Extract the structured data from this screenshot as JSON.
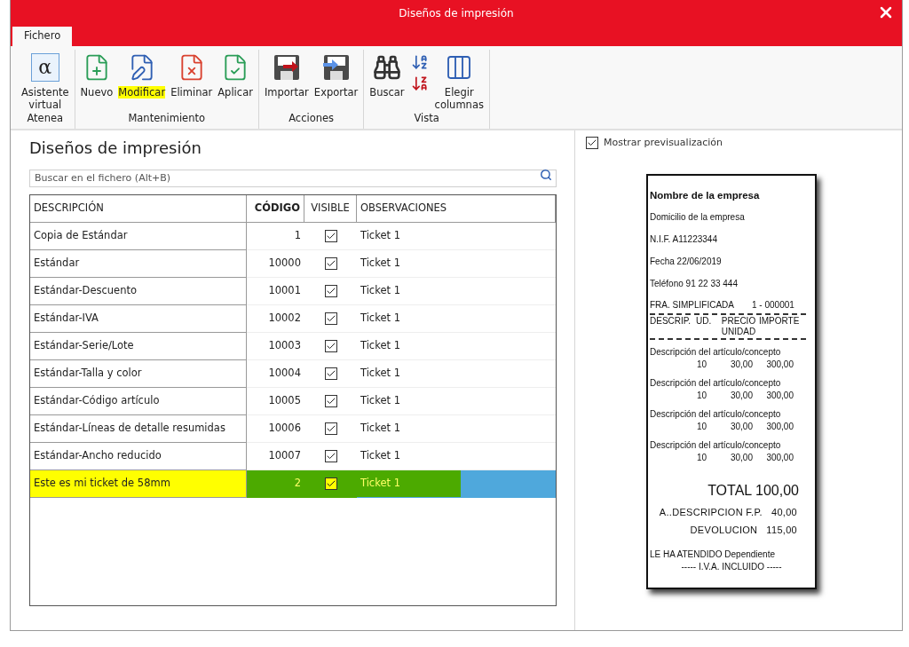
{
  "window": {
    "title": "Diseños de impresión"
  },
  "ribbon": {
    "tabs": [
      {
        "label": "Fichero",
        "selected": true
      }
    ],
    "groups": [
      {
        "label": "Atenea",
        "buttons": [
          {
            "kind": "alpha",
            "glyph": "α",
            "label": "Asistente virtual",
            "highlighted": false
          }
        ]
      },
      {
        "label": "Mantenimiento",
        "buttons": [
          {
            "kind": "new",
            "label": "Nuevo",
            "highlighted": false
          },
          {
            "kind": "edit",
            "label": "Modificar",
            "highlighted": true
          },
          {
            "kind": "delete",
            "label": "Eliminar",
            "highlighted": false
          },
          {
            "kind": "apply",
            "label": "Aplicar",
            "highlighted": false
          }
        ]
      },
      {
        "label": "Acciones",
        "buttons": [
          {
            "kind": "import",
            "label": "Importar",
            "highlighted": false
          },
          {
            "kind": "export",
            "label": "Exportar",
            "highlighted": false
          }
        ]
      },
      {
        "label": "Vista",
        "buttons": [
          {
            "kind": "search",
            "label": "Buscar",
            "highlighted": false
          },
          {
            "kind": "sort"
          },
          {
            "kind": "columns",
            "label": "Elegir columnas",
            "highlighted": false
          }
        ]
      }
    ]
  },
  "list": {
    "title": "Diseños de impresión",
    "search": {
      "placeholder": "Buscar en el fichero (Alt+B)"
    },
    "columns": [
      {
        "label": "DESCRIPCIÓN",
        "sorted": false
      },
      {
        "label": "CÓDIGO",
        "sorted": true
      },
      {
        "label": "VISIBLE",
        "sorted": false
      },
      {
        "label": "OBSERVACIONES",
        "sorted": false
      }
    ],
    "rows": [
      {
        "descripcion": "Copia de Estándar",
        "codigo": "1",
        "visible": true,
        "observaciones": "Ticket 1",
        "selected": false
      },
      {
        "descripcion": "Estándar",
        "codigo": "10000",
        "visible": true,
        "observaciones": "Ticket 1",
        "selected": false
      },
      {
        "descripcion": "Estándar-Descuento",
        "codigo": "10001",
        "visible": true,
        "observaciones": "Ticket 1",
        "selected": false
      },
      {
        "descripcion": "Estándar-IVA",
        "codigo": "10002",
        "visible": true,
        "observaciones": "Ticket 1",
        "selected": false
      },
      {
        "descripcion": "Estándar-Serie/Lote",
        "codigo": "10003",
        "visible": true,
        "observaciones": "Ticket 1",
        "selected": false
      },
      {
        "descripcion": "Estándar-Talla y color",
        "codigo": "10004",
        "visible": true,
        "observaciones": "Ticket 1",
        "selected": false
      },
      {
        "descripcion": "Estándar-Código artículo",
        "codigo": "10005",
        "visible": true,
        "observaciones": "Ticket 1",
        "selected": false
      },
      {
        "descripcion": "Estándar-Líneas de detalle resumidas",
        "codigo": "10006",
        "visible": true,
        "observaciones": "Ticket 1",
        "selected": false
      },
      {
        "descripcion": "Estándar-Ancho reducido",
        "codigo": "10007",
        "visible": true,
        "observaciones": "Ticket 1",
        "selected": false
      },
      {
        "descripcion": "Este es mi ticket de 58mm",
        "codigo": "2",
        "visible": true,
        "observaciones": "Ticket 1",
        "selected": true
      }
    ]
  },
  "preview": {
    "show": {
      "label": "Mostrar previsualización",
      "checked": true
    },
    "receipt": {
      "company": "Nombre de la empresa",
      "lines": [
        "Domicilio de la empresa",
        "N.I.F.  A11223344",
        "Fecha 22/06/2019",
        "Teléfono 91 22 33 444"
      ],
      "invoice": [
        "FRA. SIMPLIFICADA",
        "1 - 000001"
      ],
      "headers": [
        "DESCRIP.",
        "UD.",
        "PRECIO",
        "IMPORTE"
      ],
      "header_sub": "UNIDAD",
      "items": [
        {
          "description": "Descripción del artículo/concepto",
          "ud": "10",
          "precio": "30,00",
          "importe": "300,00"
        },
        {
          "description": "Descripción del artículo/concepto",
          "ud": "10",
          "precio": "30,00",
          "importe": "300,00"
        },
        {
          "description": "Descripción del artículo/concepto",
          "ud": "10",
          "precio": "30,00",
          "importe": "300,00"
        },
        {
          "description": "Descripción del artículo/concepto",
          "ud": "10",
          "precio": "30,00",
          "importe": "300,00"
        }
      ],
      "total": "TOTAL 100,00",
      "payments": [
        {
          "label": "A..DESCRIPCION F.P.",
          "amount": "40,00"
        },
        {
          "label": "DEVOLUCION",
          "amount": "115,00"
        }
      ],
      "footer": [
        "LE HA ATENDIDO Dependiente",
        "----- I.V.A. INCLUIDO -----"
      ]
    }
  }
}
